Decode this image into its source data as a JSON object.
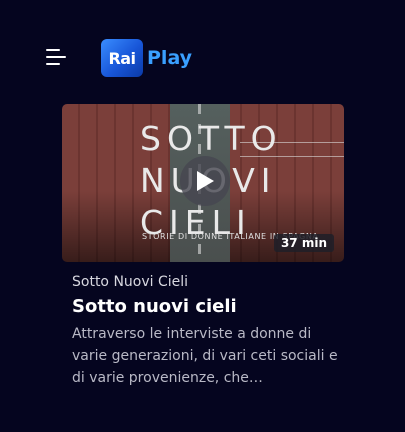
{
  "header": {
    "menu_icon": "hamburger-menu-icon",
    "logo": {
      "part1": "Rai",
      "part2": "Play"
    }
  },
  "card": {
    "thumbnail": {
      "title_art": [
        "SOTTO",
        "NUOVI",
        "CIELI"
      ],
      "subtitle_art": "STORIE DI DONNE ITALIANE IN SPAGNA",
      "play_icon": "play-icon",
      "duration": "37 min"
    },
    "category": "Sotto Nuovi Cieli",
    "title": "Sotto nuovi cieli",
    "description": "Attraverso le interviste a donne di varie generazioni, di vari ceti sociali e di varie provenienze, che…"
  },
  "colors": {
    "background": "#05051f",
    "logo_blue": "#1856d8",
    "logo_play": "#3aa0ff"
  }
}
